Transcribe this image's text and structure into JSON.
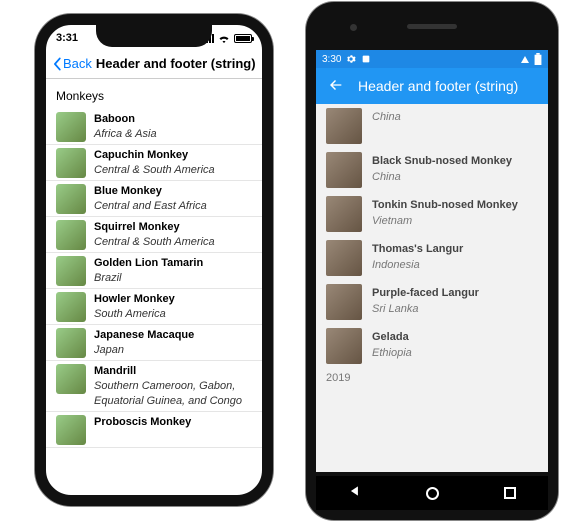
{
  "ios": {
    "status_time": "3:31",
    "nav_back": "Back",
    "nav_title": "Header and footer (string)",
    "list_header": "Monkeys",
    "items": [
      {
        "name": "Baboon",
        "loc": "Africa & Asia"
      },
      {
        "name": "Capuchin Monkey",
        "loc": "Central & South America"
      },
      {
        "name": "Blue Monkey",
        "loc": "Central and East Africa"
      },
      {
        "name": "Squirrel Monkey",
        "loc": "Central & South America"
      },
      {
        "name": "Golden Lion Tamarin",
        "loc": "Brazil"
      },
      {
        "name": "Howler Monkey",
        "loc": "South America"
      },
      {
        "name": "Japanese Macaque",
        "loc": "Japan"
      },
      {
        "name": "Mandrill",
        "loc": "Southern Cameroon, Gabon, Equatorial Guinea, and Congo"
      },
      {
        "name": "Proboscis Monkey",
        "loc": ""
      }
    ]
  },
  "android": {
    "status_time": "3:30",
    "appbar_title": "Header and footer (string)",
    "items": [
      {
        "name": "",
        "loc": "China"
      },
      {
        "name": "Black Snub-nosed Monkey",
        "loc": "China"
      },
      {
        "name": "Tonkin Snub-nosed Monkey",
        "loc": "Vietnam"
      },
      {
        "name": "Thomas's Langur",
        "loc": "Indonesia"
      },
      {
        "name": "Purple-faced Langur",
        "loc": "Sri Lanka"
      },
      {
        "name": "Gelada",
        "loc": "Ethiopia"
      }
    ],
    "footer": "2019"
  }
}
